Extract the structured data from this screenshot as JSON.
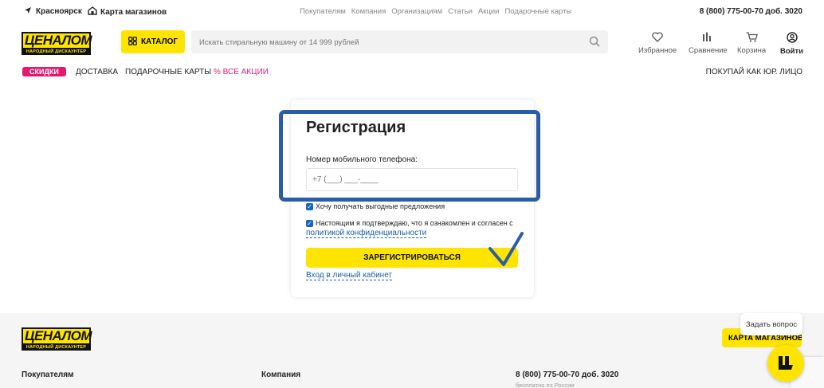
{
  "topbar": {
    "city": "Красноярск",
    "stores": "Карта магазинов",
    "links": [
      "Покупателям",
      "Компания",
      "Организациям",
      "Статьи",
      "Акции",
      "Подарочные карты"
    ],
    "phone": "8 (800) 775-00-70 доб. 3020"
  },
  "header": {
    "logo_text": "ЦЕНАЛОМ",
    "logo_sub": "НАРОДНЫЙ ДИСКАУНТЕР",
    "catalog": "КАТАЛОГ",
    "search_placeholder": "Искать стиральную машину от 14 999 рублей",
    "favorites": "Избранное",
    "compare": "Сравнение",
    "cart": "Корзина",
    "login": "Войти"
  },
  "nav": {
    "sale": "СКИДКИ",
    "delivery": "ДОСТАВКА",
    "gift_cards": "ПОДАРОЧНЫЕ КАРТЫ",
    "promos": "% ВСЕ АКЦИИ",
    "legal": "ПОКУПАЙ КАК ЮР. ЛИЦО"
  },
  "form": {
    "title": "Регистрация",
    "phone_label": "Номер мобильного телефона:",
    "phone_placeholder": "+7 (___) ___-____",
    "offers_checkbox": "Хочу получать выгодные предложения",
    "consent_checkbox": "Настоящим я подтверждаю, что я ознакомлен и согласен с",
    "policy_link": "политикой конфиденциальности",
    "submit": "ЗАРЕГИСТРИРОВАТЬСЯ",
    "login_link": "Вход в личный кабинет"
  },
  "footer": {
    "logo_text": "ЦЕНАЛОМ",
    "logo_sub": "НАРОДНЫЙ ДИСКАУНТЕР",
    "map_button": "КАРТА МАГАЗИНОВ",
    "col_buyers": "Покупателям",
    "col_company": "Компания",
    "phone": "8 (800) 775-00-70 доб. 3020",
    "free": "бесплатно по России"
  },
  "widget": {
    "ask": "Задать вопрос"
  },
  "colors": {
    "brand_yellow": "#ffe400",
    "accent_pink": "#e6186e",
    "link_blue": "#1a5ea8",
    "annotation_blue": "#2a5da8"
  }
}
